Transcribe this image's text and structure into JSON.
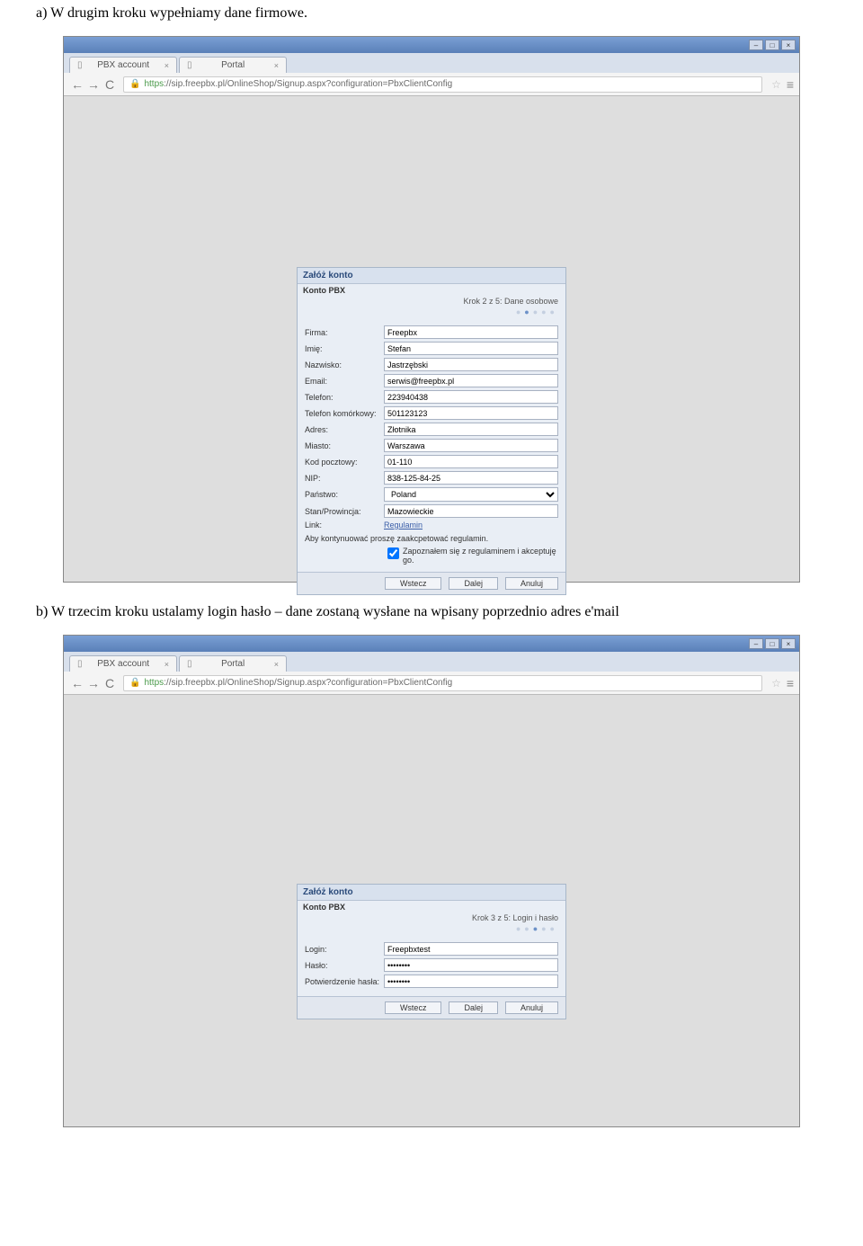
{
  "doc": {
    "line_a": "a)  W drugim kroku wypełniamy dane firmowe.",
    "line_b": "b)  W trzecim kroku ustalamy login hasło – dane zostaną wysłane na wpisany poprzednio adres e'mail"
  },
  "browser": {
    "tabs": [
      {
        "title": "PBX account"
      },
      {
        "title": "Portal"
      }
    ],
    "url_https": "https",
    "url_rest": "://sip.freepbx.pl/OnlineShop/Signup.aspx?configuration=PbxClientConfig",
    "win": {
      "min": "–",
      "max": "□",
      "close": "×"
    }
  },
  "panel2": {
    "title": "Załóż konto",
    "sub": "Konto PBX",
    "step": "Krok 2 z 5: Dane osobowe",
    "labels": {
      "firma": "Firma:",
      "imie": "Imię:",
      "nazwisko": "Nazwisko:",
      "email": "Email:",
      "telefon": "Telefon:",
      "telefon_kom": "Telefon komórkowy:",
      "adres": "Adres:",
      "miasto": "Miasto:",
      "kod": "Kod pocztowy:",
      "nip": "NIP:",
      "panstwo": "Państwo:",
      "stan": "Stan/Prowincja:",
      "link": "Link:"
    },
    "values": {
      "firma": "Freepbx",
      "imie": "Stefan",
      "nazwisko": "Jastrzębski",
      "email": "serwis@freepbx.pl",
      "telefon": "223940438",
      "telefon_kom": "501123123",
      "adres": "Złotnika",
      "miasto": "Warszawa",
      "kod": "01-110",
      "nip": "838-125-84-25",
      "panstwo": "Poland",
      "stan": "Mazowieckie",
      "link_text": "Regulamin"
    },
    "note": "Aby kontynuować proszę zaakcpetować regulamin.",
    "checkbox_label": "Zapoznałem się z regulaminem i akceptuję go.",
    "buttons": {
      "wstecz": "Wstecz",
      "dalej": "Dalej",
      "anuluj": "Anuluj"
    }
  },
  "panel3": {
    "title": "Załóż konto",
    "sub": "Konto PBX",
    "step": "Krok 3 z 5: Login i hasło",
    "labels": {
      "login": "Login:",
      "haslo": "Hasło:",
      "potw": "Potwierdzenie hasła:"
    },
    "values": {
      "login": "Freepbxtest",
      "haslo": "••••••••",
      "potw": "••••••••"
    },
    "buttons": {
      "wstecz": "Wstecz",
      "dalej": "Dalej",
      "anuluj": "Anuluj"
    }
  }
}
